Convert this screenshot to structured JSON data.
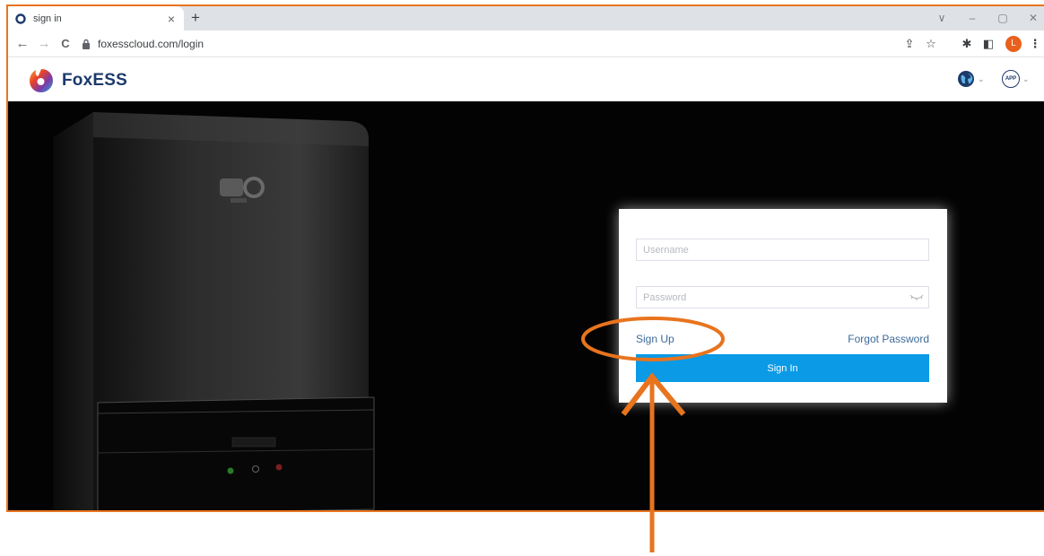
{
  "browser": {
    "tab_title": "sign in",
    "tab_close": "×",
    "new_tab": "+",
    "url": "foxesscloud.com/login",
    "profile_initial": "L",
    "window_controls": {
      "chevron": "∨",
      "minimize": "–",
      "restore": "▢",
      "close": "✕"
    },
    "nav": {
      "back": "←",
      "forward": "→",
      "reload": "C"
    },
    "toolbar_icons": {
      "share": "⇪",
      "star": "☆",
      "extensions": "✱",
      "sidepanel": "◧",
      "menu": "⋮"
    }
  },
  "site": {
    "logo_text": "FoxESS",
    "language_chevron": "⌄",
    "app_label": "APP",
    "app_chevron": "⌄"
  },
  "login": {
    "username_placeholder": "Username",
    "password_placeholder": "Password",
    "signup_label": "Sign Up",
    "forgot_label": "Forgot Password",
    "signin_label": "Sign In"
  },
  "colors": {
    "annotation": "#e8741e",
    "primary_button": "#0a9ae6",
    "link": "#3d6a9a",
    "brand_text": "#1d3a6b",
    "hero_bg": "#030303"
  },
  "icons": [
    "fox-logo-icon",
    "lock-icon",
    "globe-icon",
    "app-icon",
    "eye-closed-icon"
  ]
}
